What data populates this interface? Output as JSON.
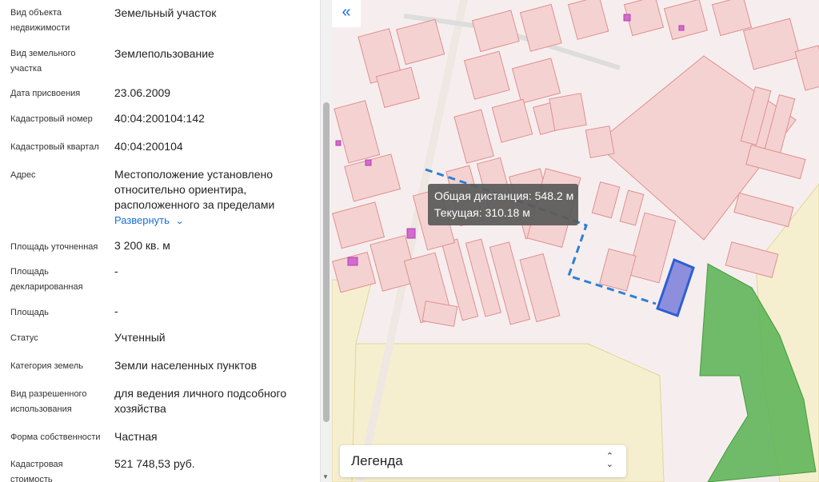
{
  "properties": [
    {
      "label": "Вид объекта недвижимости",
      "value": "Земельный участок"
    },
    {
      "label": "Вид земельного участка",
      "value": "Землепользование"
    },
    {
      "label": "Дата присвоения",
      "value": "23.06.2009"
    },
    {
      "label": "Кадастровый номер",
      "value": "40:04:200104:142"
    },
    {
      "label": "Кадастровый квартал",
      "value": "40:04:200104"
    },
    {
      "label": "Адрес",
      "value": "Местоположение установлено относительно ориентира, расположенного за пределами"
    },
    {
      "label": "Площадь уточненная",
      "value": "3 200 кв. м"
    },
    {
      "label": "Площадь декларированная",
      "value": "-"
    },
    {
      "label": "Площадь",
      "value": "-"
    },
    {
      "label": "Статус",
      "value": "Учтенный"
    },
    {
      "label": "Категория земель",
      "value": "Земли населенных пунктов"
    },
    {
      "label": "Вид разрешенного использования",
      "value": "для ведения личного подсобного хозяйства"
    },
    {
      "label": "Форма собственности",
      "value": "Частная"
    },
    {
      "label": "Кадастровая стоимость",
      "value": "521 748,53 руб."
    }
  ],
  "address_expand": {
    "label": "Развернуть",
    "icon": "chevron-down-icon"
  },
  "map": {
    "collapse_icon": "«",
    "measure": {
      "total_label": "Общая дистанция: 548.2 м",
      "current_label": "Текущая: 310.18 м"
    },
    "legend": {
      "label": "Легенда",
      "toggle_icon": "⌃⌄"
    },
    "colors": {
      "parcel_fill": "#f5d2d2",
      "parcel_stroke": "#e08f8f",
      "zone_yellow": "#f6efcf",
      "forest_green": "#62b55a",
      "selected_parcel": "#6b6fd6",
      "measure_line": "#2d7fd6",
      "link_blue": "#1a6fd6"
    }
  }
}
